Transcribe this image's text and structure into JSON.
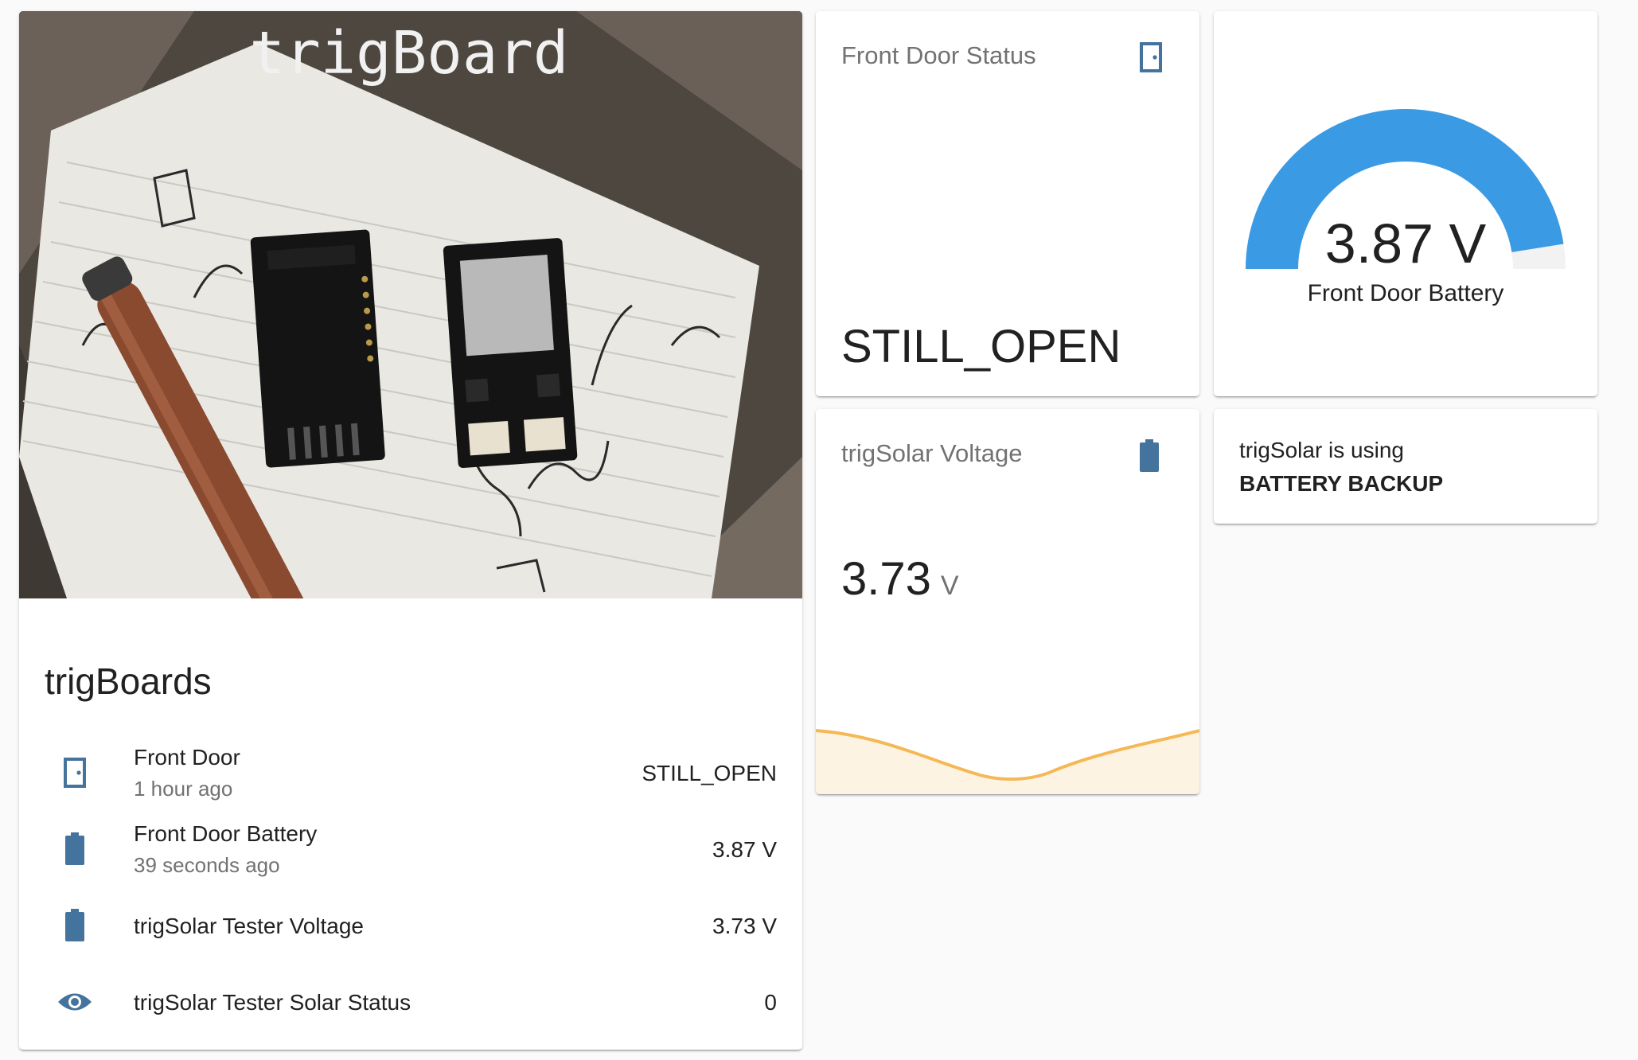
{
  "colors": {
    "icon": "#44739e",
    "gauge_fill": "#3a9ae4",
    "gauge_track": "#f2f2f2",
    "spark_line": "#f5b856",
    "spark_fill": "#fdf3e3",
    "secondary_text": "#727272"
  },
  "picture_card": {
    "photo_text": "trigBoard",
    "title": "trigBoards",
    "entities": [
      {
        "icon": "door-icon",
        "name": "Front Door",
        "secondary": "1 hour ago",
        "value": "STILL_OPEN"
      },
      {
        "icon": "battery-icon",
        "name": "Front Door Battery",
        "secondary": "39 seconds ago",
        "value": "3.87 V"
      },
      {
        "icon": "battery-icon",
        "name": "trigSolar Tester Voltage",
        "secondary": "",
        "value": "3.73 V"
      },
      {
        "icon": "eye-icon",
        "name": "trigSolar Tester Solar Status",
        "secondary": "",
        "value": "0"
      }
    ]
  },
  "door_status_card": {
    "title": "Front Door Status",
    "icon": "door-icon",
    "state": "STILL_OPEN"
  },
  "gauge_card": {
    "value_text": "3.87 V",
    "label": "Front Door Battery",
    "fill_fraction": 0.95
  },
  "voltage_card": {
    "title": "trigSolar Voltage",
    "icon": "battery-icon",
    "value": "3.73",
    "unit": "V"
  },
  "markdown_card": {
    "line1": "trigSolar is using",
    "line2": "BATTERY BACKUP"
  }
}
